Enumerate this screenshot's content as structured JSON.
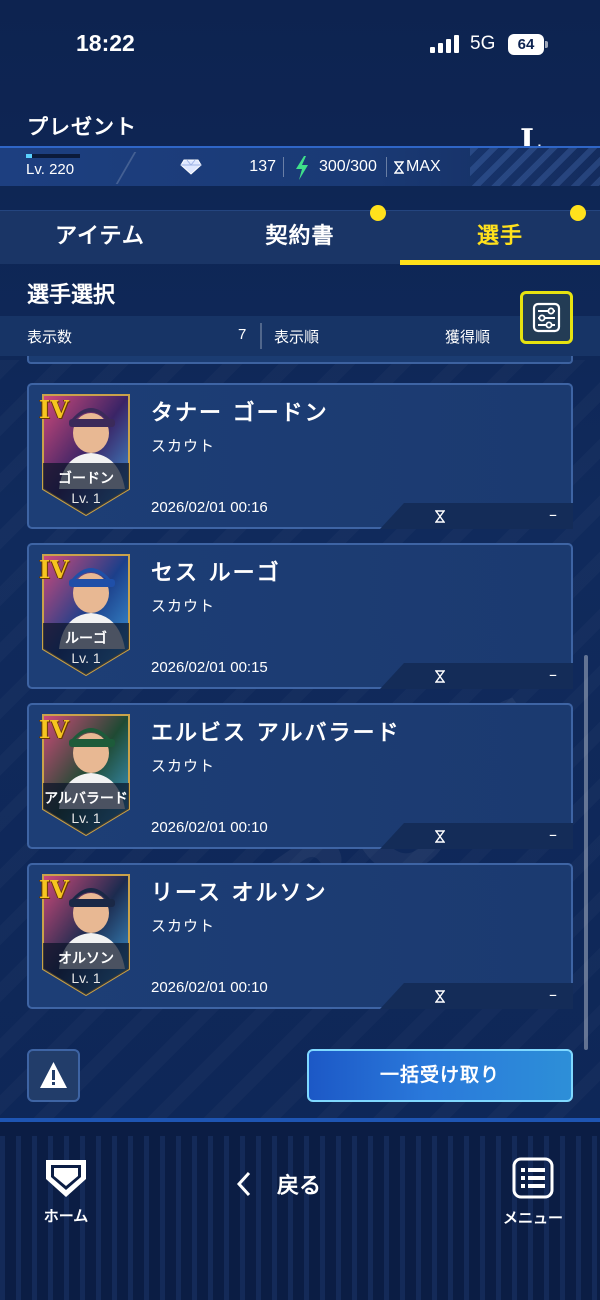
{
  "status_bar": {
    "time": "18:22",
    "network": "5G",
    "battery": "64"
  },
  "header": {
    "title": "プレゼント",
    "level": "Lv. 220",
    "gems": "137",
    "stamina": "300/300",
    "stamina_max": "MAX",
    "logo": "LA"
  },
  "tabs": [
    {
      "label": "アイテム",
      "active": false,
      "badge": false
    },
    {
      "label": "契約書",
      "active": false,
      "badge": true
    },
    {
      "label": "選手",
      "active": true,
      "badge": true
    }
  ],
  "section": {
    "title": "選手選択",
    "count_label": "表示数",
    "count_value": "7",
    "order_label": "表示順",
    "order_value": "獲得順"
  },
  "players": [
    {
      "rank": "IV",
      "short_name": "ゴードン",
      "level": "Lv. 1",
      "name": "タナー ゴードン",
      "source": "スカウト",
      "date": "2026/02/01 00:16",
      "expiry": "–",
      "team_color": "#3a2466",
      "cap_color": "#3b2a5a"
    },
    {
      "rank": "IV",
      "short_name": "ルーゴ",
      "level": "Lv. 1",
      "name": "セス ルーゴ",
      "source": "スカウト",
      "date": "2026/02/01 00:15",
      "expiry": "–",
      "team_color": "#1c3f8a",
      "cap_color": "#1f4fa8"
    },
    {
      "rank": "IV",
      "short_name": "アルバラード",
      "level": "Lv. 1",
      "name": "エルビス アルバラード",
      "source": "スカウト",
      "date": "2026/02/01 00:10",
      "expiry": "–",
      "team_color": "#1f4a33",
      "cap_color": "#1d5b3a"
    },
    {
      "rank": "IV",
      "short_name": "オルソン",
      "level": "Lv. 1",
      "name": "リース オルソン",
      "source": "スカウト",
      "date": "2026/02/01 00:10",
      "expiry": "–",
      "team_color": "#1c2b4f",
      "cap_color": "#1a2846"
    }
  ],
  "actions": {
    "warning_icon": "warning-icon",
    "claim_all": "一括受け取り"
  },
  "bottom_nav": {
    "home": "ホーム",
    "back": "戻る",
    "menu": "メニュー"
  },
  "colors": {
    "accent": "#ffe11c",
    "background": "#102a5c",
    "card": "#1d3e76",
    "claim_button": "#2a79db"
  }
}
